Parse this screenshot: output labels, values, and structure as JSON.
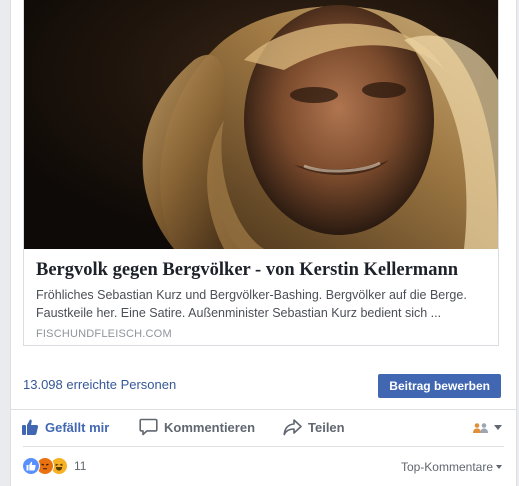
{
  "preview": {
    "headline": "Bergvolk gegen Bergvölker - von Kerstin Kellermann",
    "description": "Fröhliches Sebastian Kurz und Bergvölker-Bashing. Bergvölker auf die Berge. Faustkeile her. Eine Satire. Außenminister Sebastian Kurz bedient sich ...",
    "domain": "FISCHUNDFLEISCH.COM",
    "image_icon": "photo-of-woman-with-blond-hair"
  },
  "reach": {
    "text": "13.098 erreichte Personen",
    "boost_label": "Beitrag bewerben"
  },
  "actions": {
    "like_label": "Gefällt mir",
    "comment_label": "Kommentieren",
    "share_label": "Teilen",
    "audience_icon": "friends-icon"
  },
  "reactions": {
    "count": "11",
    "icons": [
      "like-reaction-icon",
      "angry-reaction-icon",
      "haha-reaction-icon"
    ],
    "sort_label": "Top-Kommentare"
  },
  "colors": {
    "link_blue": "#365899",
    "button_blue": "#4267b2",
    "text_gray": "#616770",
    "background": "#e9ebee"
  }
}
